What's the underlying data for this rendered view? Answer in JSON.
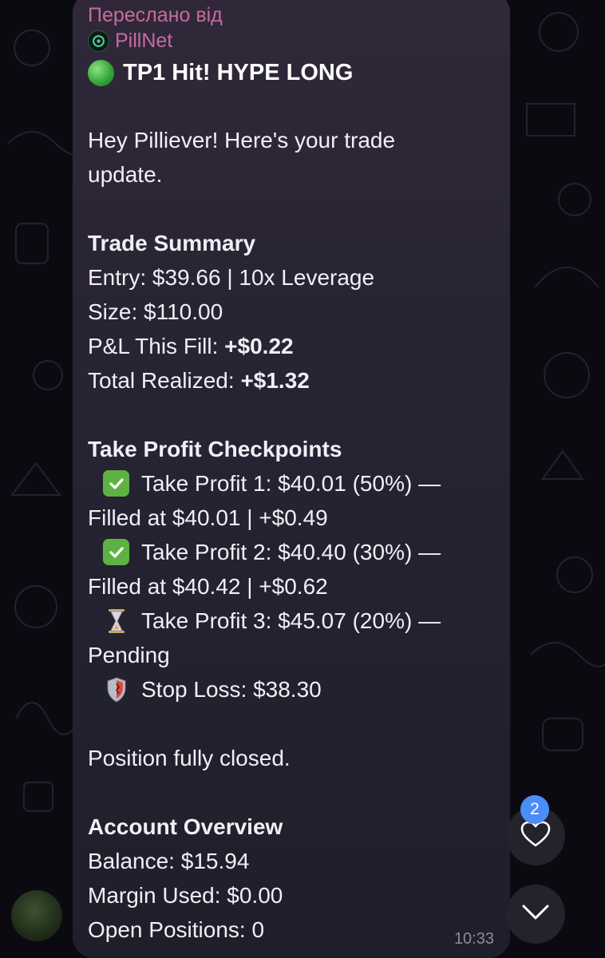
{
  "forward": {
    "label": "Переслано від",
    "source": "PillNet"
  },
  "message": {
    "title": "TP1 Hit! HYPE LONG",
    "greeting_1": "Hey Pilliever! Here's your trade",
    "greeting_2": "update.",
    "trade_summary": {
      "heading": "Trade Summary",
      "entry": "Entry: $39.66 | 10x Leverage",
      "size": "Size: $110.00",
      "pnl_label": "P&L This Fill: ",
      "pnl_value": "+$0.22",
      "realized_label": "Total Realized: ",
      "realized_value": "+$1.32"
    },
    "checkpoints": {
      "heading": "Take Profit Checkpoints",
      "tp1_line1": "Take Profit 1: $40.01 (50%) —",
      "tp1_line2": "Filled at $40.01 | +$0.49",
      "tp2_line1": "Take Profit 2: $40.40 (30%) —",
      "tp2_line2": "Filled at $40.42 | +$0.62",
      "tp3_line1": "Take Profit 3: $45.07 (20%) —",
      "tp3_line2": "Pending",
      "stop_loss": "Stop Loss: $38.30"
    },
    "position_status": "Position fully closed.",
    "account": {
      "heading": "Account Overview",
      "balance": "Balance: $15.94",
      "margin": "Margin Used: $0.00",
      "open_positions": "Open Positions: 0"
    },
    "time": "10:33"
  },
  "reactions": {
    "count": "2"
  },
  "colors": {
    "accent_pink": "#c86aa0",
    "badge_blue": "#4b8ef7",
    "check_green": "#5cb342"
  },
  "icons": [
    "green-circle-icon",
    "check-mark-icon",
    "hourglass-icon",
    "shield-icon",
    "heart-icon",
    "chevron-down-icon"
  ]
}
